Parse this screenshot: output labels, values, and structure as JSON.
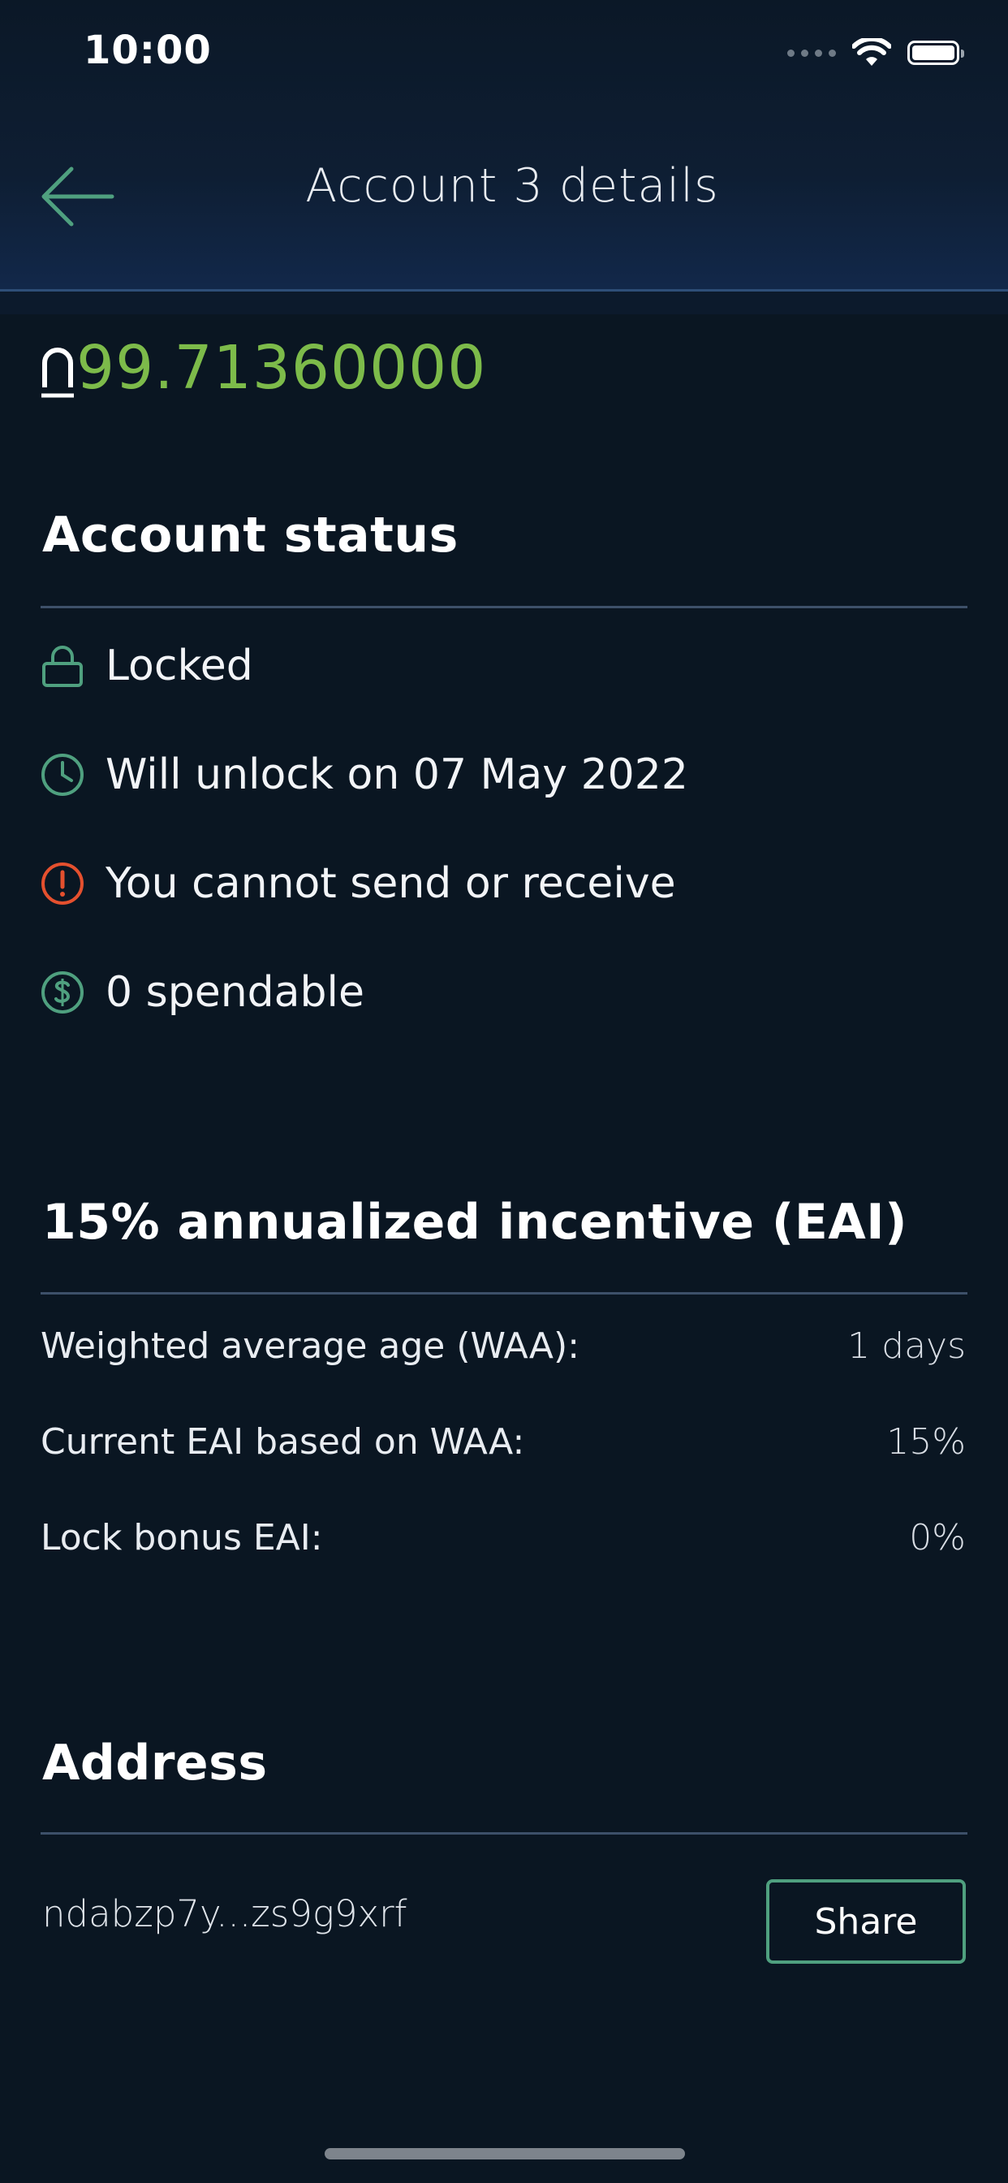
{
  "status_bar": {
    "time": "10:00"
  },
  "nav": {
    "title": "Account 3 details"
  },
  "balance": {
    "value": "99.71360000"
  },
  "account_status": {
    "title": "Account status",
    "items": [
      {
        "icon": "lock-icon",
        "label": "Locked"
      },
      {
        "icon": "clock-icon",
        "label": "Will unlock on 07 May 2022"
      },
      {
        "icon": "warning-icon",
        "label": "You cannot send or receive"
      },
      {
        "icon": "dollar-icon",
        "label": "0 spendable"
      }
    ]
  },
  "incentive": {
    "title": "15% annualized incentive (EAI)",
    "rows": [
      {
        "label": "Weighted average age (WAA):",
        "value": "1 days"
      },
      {
        "label": "Current EAI based on WAA:",
        "value": "15%"
      },
      {
        "label": "Lock bonus EAI:",
        "value": "0%"
      }
    ]
  },
  "address": {
    "title": "Address",
    "value": "ndabzp7y...zs9g9xrf",
    "share_label": "Share"
  },
  "colors": {
    "background": "#0a1622",
    "accent_green": "#4fa07f",
    "balance_green": "#7dbb4a",
    "warning_red": "#e5502e"
  }
}
